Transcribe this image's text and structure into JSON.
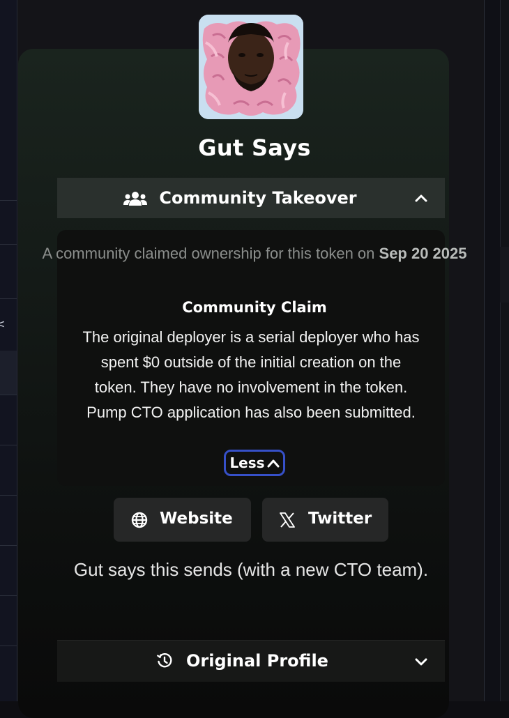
{
  "token": {
    "name": "Gut Says"
  },
  "community_takeover": {
    "label": "Community Takeover",
    "intro_prefix": "A community claimed ownership for this token on",
    "date": "Sep 20 2025",
    "claim_heading": "Community Claim",
    "claim_text": "The original deployer is a serial deployer who has spent $0 outside of the initial creation on the token. They have no involvement in the token. Pump CTO application has also been submitted.",
    "less_label": "Less"
  },
  "links": {
    "website_label": "Website",
    "twitter_label": "Twitter"
  },
  "description": "Gut says this sends (with a new CTO team).",
  "original_profile": {
    "label": "Original Profile"
  },
  "colors": {
    "focus_ring": "#3650c8",
    "section_bar": "#2a302d",
    "pill_bg": "#262727"
  },
  "icons": [
    "users-icon",
    "chevron-up-icon",
    "globe-icon",
    "x-logo-icon",
    "history-icon",
    "chevron-down-icon"
  ]
}
